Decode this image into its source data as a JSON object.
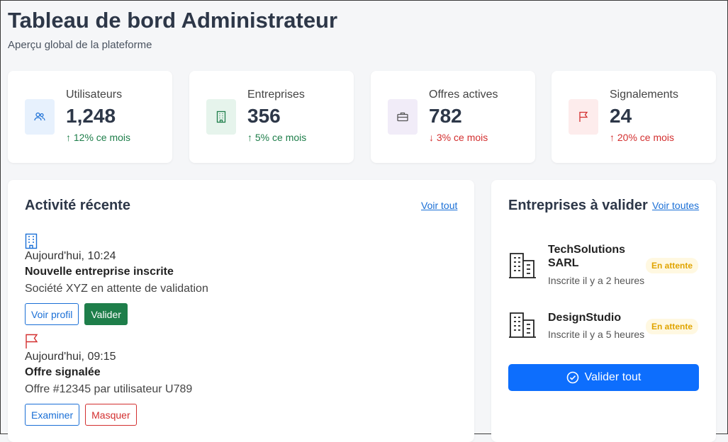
{
  "header": {
    "title": "Tableau de bord Administrateur",
    "subtitle": "Aperçu global de la plateforme"
  },
  "stats": [
    {
      "label": "Utilisateurs",
      "value": "1,248",
      "trend": "↑ 12% ce mois",
      "direction": "up",
      "icon": "users-icon",
      "color": "#1a6fd6",
      "bg": "#e7f1fd"
    },
    {
      "label": "Entreprises",
      "value": "356",
      "trend": "↑ 5% ce mois",
      "direction": "up",
      "icon": "building-icon",
      "color": "#1e7e4a",
      "bg": "#e6f4ec"
    },
    {
      "label": "Offres actives",
      "value": "782",
      "trend": "↓ 3% ce mois",
      "direction": "down",
      "icon": "briefcase-icon",
      "color": "#555555",
      "bg": "#f1ecf8"
    },
    {
      "label": "Signalements",
      "value": "24",
      "trend": "↑ 20% ce mois",
      "direction": "up-bad",
      "icon": "flag-icon",
      "color": "#d32f2f",
      "bg": "#fdecec"
    }
  ],
  "activity": {
    "title": "Activité récente",
    "see_all": "Voir tout",
    "items": [
      {
        "icon": "building-icon",
        "time": "Aujourd'hui, 10:24",
        "title": "Nouvelle entreprise inscrite",
        "desc": "Société XYZ en attente de validation",
        "btn1": "Voir profil",
        "btn2": "Valider"
      },
      {
        "icon": "flag-icon",
        "time": "Aujourd'hui, 09:15",
        "title": "Offre signalée",
        "desc": "Offre #12345 par utilisateur U789",
        "btn1": "Examiner",
        "btn2": "Masquer"
      }
    ]
  },
  "pending": {
    "title": "Entreprises à valider",
    "see_all": "Voir toutes",
    "companies": [
      {
        "name": "TechSolutions SARL",
        "registered": "Inscrite il y a 2 heures",
        "status": "En attente"
      },
      {
        "name": "DesignStudio",
        "registered": "Inscrite il y a 5 heures",
        "status": "En attente"
      }
    ],
    "validate_all": "Valider tout"
  },
  "colors": {
    "accent": "#0d6efd",
    "success": "#1e7e4a",
    "danger": "#d32f2f",
    "warning": "#e0a400"
  }
}
